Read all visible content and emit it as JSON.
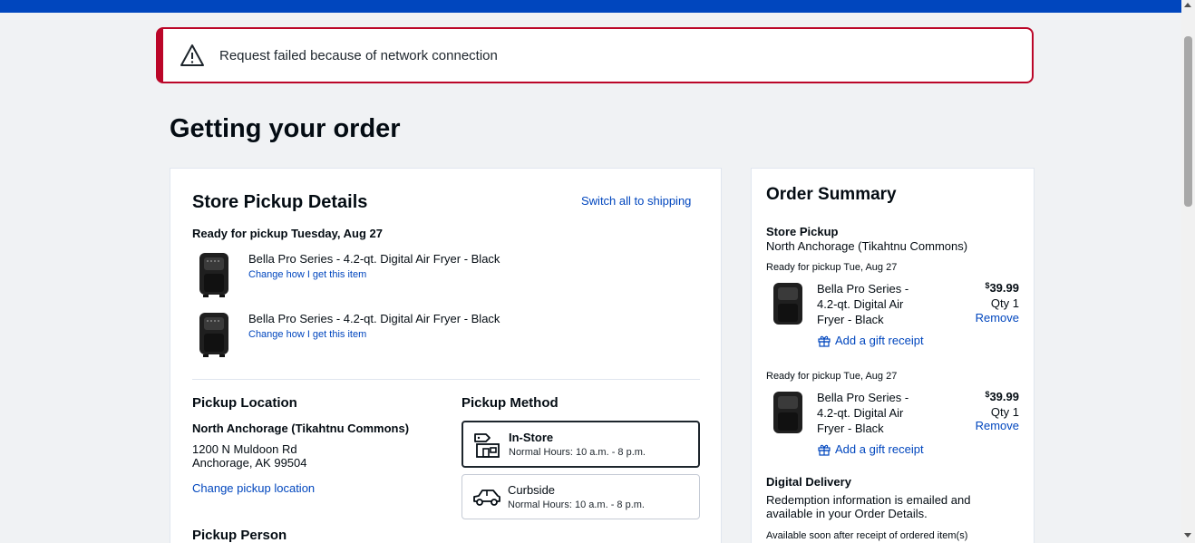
{
  "alert": {
    "message": "Request failed because of network connection"
  },
  "page": {
    "title": "Getting your order"
  },
  "pickup_details": {
    "title": "Store Pickup Details",
    "switch_link": "Switch all to shipping",
    "ready_label": "Ready for pickup Tuesday, Aug 27",
    "items": [
      {
        "name": "Bella Pro Series - 4.2-qt. Digital Air Fryer - Black",
        "change_link": "Change how I get this item"
      },
      {
        "name": "Bella Pro Series - 4.2-qt. Digital Air Fryer - Black",
        "change_link": "Change how I get this item"
      }
    ]
  },
  "pickup_location": {
    "title": "Pickup Location",
    "store_name": "North Anchorage (Tikahtnu Commons)",
    "address_line1": "1200 N Muldoon Rd",
    "address_line2": "Anchorage, AK 99504",
    "change_link": "Change pickup location"
  },
  "pickup_method": {
    "title": "Pickup Method",
    "options": [
      {
        "title": "In-Store",
        "hours": "Normal Hours: 10 a.m. - 8 p.m.",
        "selected": true,
        "icon": "store-icon"
      },
      {
        "title": "Curbside",
        "hours": "Normal Hours: 10 a.m. - 8 p.m.",
        "selected": false,
        "icon": "car-icon"
      }
    ]
  },
  "pickup_person": {
    "title": "Pickup Person"
  },
  "order_summary": {
    "title": "Order Summary",
    "section_title": "Store Pickup",
    "store": "North Anchorage (Tikahtnu Commons)",
    "items": [
      {
        "ready": "Ready for pickup Tue, Aug 27",
        "name_line1": "Bella Pro Series -",
        "name_line2": "4.2-qt. Digital Air",
        "name_line3": "Fryer - Black",
        "price_symbol": "$",
        "price": "39.99",
        "qty": "Qty 1",
        "remove": "Remove",
        "gift": "Add a gift receipt"
      },
      {
        "ready": "Ready for pickup Tue, Aug 27",
        "name_line1": "Bella Pro Series -",
        "name_line2": "4.2-qt. Digital Air",
        "name_line3": "Fryer - Black",
        "price_symbol": "$",
        "price": "39.99",
        "qty": "Qty 1",
        "remove": "Remove",
        "gift": "Add a gift receipt"
      }
    ],
    "digital_title": "Digital Delivery",
    "digital_line1": "Redemption information is emailed and",
    "digital_line2": "available in your Order Details.",
    "digital_note": "Available soon after receipt of ordered item(s)"
  },
  "colors": {
    "brand_blue": "#0046be",
    "alert_red": "#bb0628",
    "link_blue": "#0046be"
  }
}
